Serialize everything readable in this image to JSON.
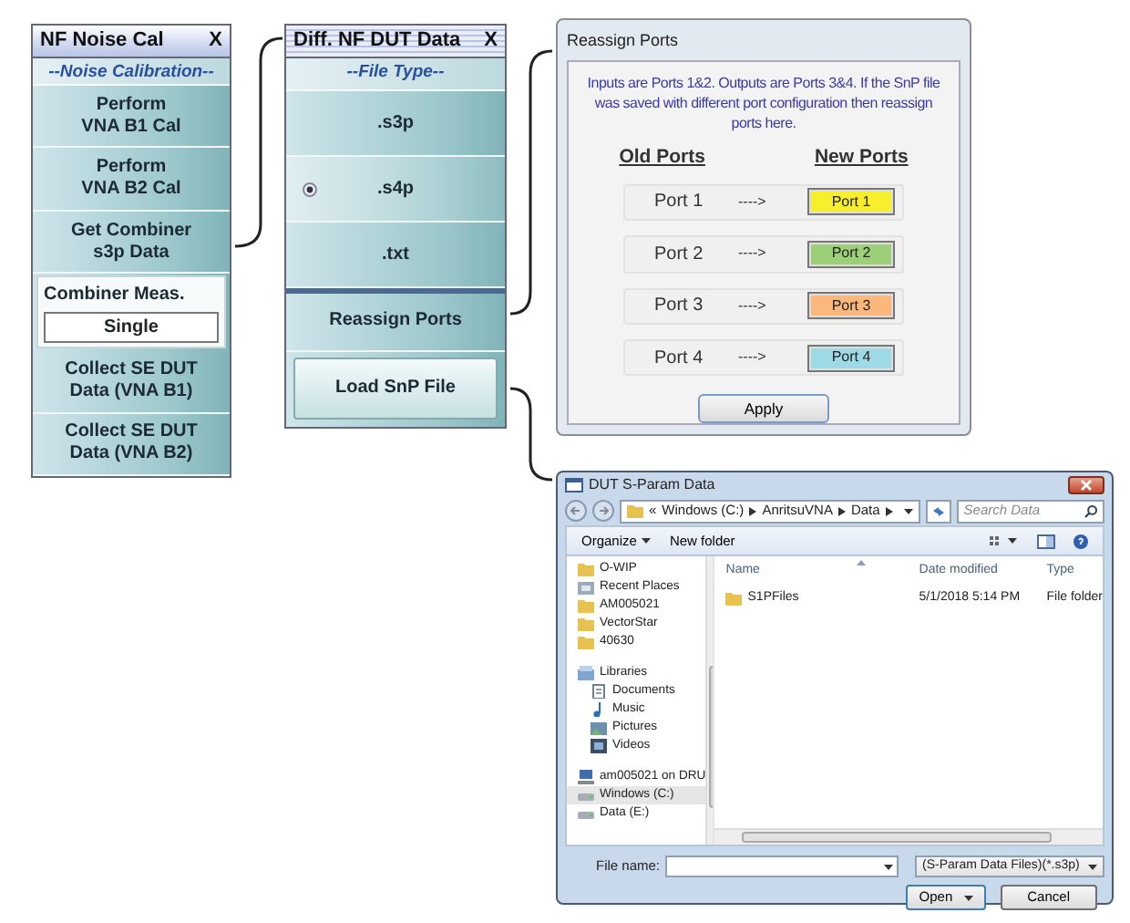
{
  "noise_cal_panel": {
    "title": "NF Noise Cal",
    "close": "X",
    "subtitle": "--Noise Calibration--",
    "items": [
      {
        "kind": "button",
        "label": "Perform\nVNA B1 Cal"
      },
      {
        "kind": "button",
        "label": "Perform\nVNA B2 Cal"
      },
      {
        "kind": "button",
        "label": "Get Combiner\ns3p Data"
      },
      {
        "kind": "select",
        "label": "Combiner Meas.",
        "value": "Single"
      },
      {
        "kind": "button",
        "label": "Collect SE DUT\nData (VNA B1)"
      },
      {
        "kind": "button",
        "label": "Collect SE DUT\nData (VNA B2)"
      }
    ]
  },
  "dut_data_panel": {
    "title": "Diff. NF DUT Data",
    "close": "X",
    "subtitle": "--File Type--",
    "file_types": [
      {
        "label": ".s3p",
        "selected": false
      },
      {
        "label": ".s4p",
        "selected": true
      },
      {
        "label": ".txt",
        "selected": false
      }
    ],
    "buttons": [
      {
        "kind": "flat",
        "label": "Reassign Ports"
      },
      {
        "kind": "raised",
        "label": "Load SnP File"
      }
    ]
  },
  "reassign_dialog": {
    "title": "Reassign Ports",
    "message": "Inputs are Ports 1&2. Outputs are Ports 3&4. If the SnP file was saved with different port configuration then reassign ports here.",
    "headers": [
      "Old Ports",
      "New Ports"
    ],
    "rows": [
      {
        "old": "Port 1",
        "arrow": "---->",
        "new": "Port 1",
        "color": "#f7ee2c"
      },
      {
        "old": "Port 2",
        "arrow": "---->",
        "new": "Port 2",
        "color": "#9dcf78"
      },
      {
        "old": "Port 3",
        "arrow": "---->",
        "new": "Port 3",
        "color": "#fcb77c"
      },
      {
        "old": "Port 4",
        "arrow": "---->",
        "new": "Port 4",
        "color": "#9ed9e6"
      }
    ],
    "button": "Apply"
  },
  "file_dialog": {
    "title": "DUT S-Param Data",
    "path_prefix": "«",
    "path": [
      "Windows (C:)",
      "AnritsuVNA",
      "Data"
    ],
    "search_placeholder": "Search Data",
    "toolbar": {
      "organize": "Organize",
      "new_folder": "New folder"
    },
    "nav_sections": [
      {
        "items": [
          {
            "label": "O-WIP",
            "kind": "folder",
            "selected": false
          },
          {
            "label": "Recent Places",
            "kind": "recent",
            "selected": false
          },
          {
            "label": "AM005021",
            "kind": "folder",
            "selected": false
          },
          {
            "label": "VectorStar",
            "kind": "folder",
            "selected": false
          },
          {
            "label": "40630",
            "kind": "folder",
            "selected": false
          }
        ]
      },
      {
        "items": [
          {
            "label": "Libraries",
            "kind": "library",
            "selected": false,
            "children": [
              {
                "label": "Documents",
                "kind": "document",
                "selected": false
              },
              {
                "label": "Music",
                "kind": "music",
                "selected": false
              },
              {
                "label": "Pictures",
                "kind": "pictures",
                "selected": false
              },
              {
                "label": "Videos",
                "kind": "videos",
                "selected": false
              }
            ]
          }
        ]
      },
      {
        "items": [
          {
            "label": "am005021 on DRU",
            "kind": "network",
            "selected": false
          },
          {
            "label": "Windows (C:)",
            "kind": "drive",
            "selected": true
          },
          {
            "label": "Data (E:)",
            "kind": "drive",
            "selected": false
          }
        ]
      }
    ],
    "columns": [
      "Name",
      "Date modified",
      "Type"
    ],
    "files": [
      {
        "name": "S1PFiles",
        "date": "5/1/2018 5:14 PM",
        "type": "File folder"
      }
    ],
    "file_name_label": "File name:",
    "filter": "(S-Param Data Files)(*.s3p)",
    "open": "Open",
    "cancel": "Cancel"
  }
}
